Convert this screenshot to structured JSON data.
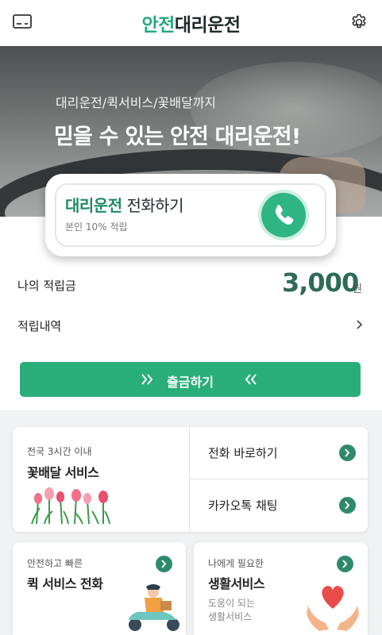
{
  "header": {
    "title_accent": "안전",
    "title_rest": "대리운전"
  },
  "hero": {
    "subtitle": "대리운전/퀵서비스/꽃배달까지",
    "headline": "믿을 수 있는 안전 대리운전!"
  },
  "call_card": {
    "label_accent": "대리운전",
    "label_rest": " 전화하기",
    "note": "본인 10% 적립"
  },
  "points": {
    "label": "나의 적립금",
    "value": "3,000",
    "unit": "원",
    "history_label": "적립내역",
    "withdraw_label": "출금하기"
  },
  "services": {
    "flower": {
      "small": "전국 3시간 이내",
      "big": "꽃배달 서비스"
    },
    "call_direct": "전화 바로하기",
    "kakao": "카카오톡 채팅",
    "quick": {
      "small": "안전하고 빠른",
      "big": "퀵 서비스 전화"
    },
    "life": {
      "small": "나에게 필요한",
      "big": "생활서비스",
      "desc1": "도움이 되는",
      "desc2": "생활서비스"
    }
  },
  "colors": {
    "accent": "#23a97a",
    "button": "#2aae79",
    "points_value": "#2e6b55",
    "arrow": "#2e8a6a"
  }
}
